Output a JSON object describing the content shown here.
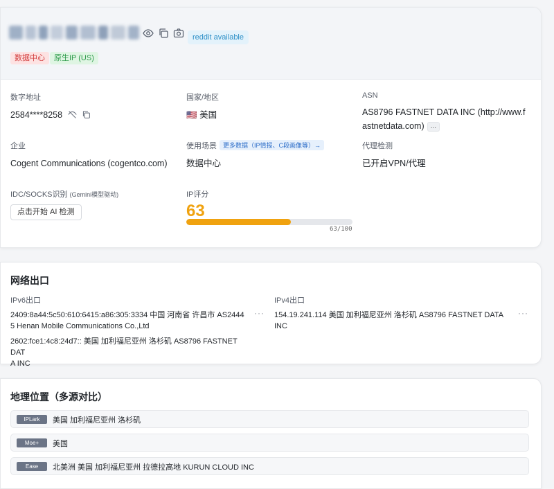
{
  "header": {
    "available_badge": "reddit available",
    "tags": [
      "数据中心",
      "原生IP (US)"
    ],
    "icons": [
      "eye-icon",
      "copy-icon",
      "camera-icon"
    ]
  },
  "info": {
    "digital_addr": {
      "label": "数字地址",
      "value": "2584****8258"
    },
    "country": {
      "label": "国家/地区",
      "flag": "🇺🇸",
      "value": "美国"
    },
    "asn": {
      "label": "ASN",
      "value_line1": "AS8796 FASTNET DATA INC (http://www.f",
      "value_line2": "astnetdata.com)",
      "more": "..."
    },
    "org": {
      "label": "企业",
      "value": "Cogent Communications (cogentco.com)"
    },
    "usage": {
      "label": "使用场景",
      "link": "更多数据（IP情报、C段画像等）→",
      "value": "数据中心"
    },
    "proxy": {
      "label": "代理检测",
      "value": "已开启VPN/代理"
    },
    "idc": {
      "label": "IDC/SOCKS识别",
      "label_note": "(Gemini模型驱动)",
      "button": "点击开始 AI 检测"
    },
    "score": {
      "label": "IP评分",
      "value": "63",
      "caption": "63/100",
      "fraction": 0.63
    }
  },
  "egress": {
    "title": "网络出口",
    "ipv6": {
      "label": "IPv6出口",
      "lines": [
        "2409:8a44:5c50:610:6415:a86:305:3334 中国 河南省 许昌市 AS2444",
        "5 Henan Mobile Communications Co.,Ltd",
        "2602:fce1:4c8:24d7:: 美国 加利福尼亚州 洛杉矶 AS8796 FASTNET DAT",
        "A INC"
      ]
    },
    "ipv4": {
      "label": "IPv4出口",
      "line": "154.19.241.114 美国 加利福尼亚州 洛杉矶 AS8796 FASTNET DATA INC"
    },
    "more": "···"
  },
  "geo": {
    "title": "地理位置（多源对比）",
    "rows": [
      {
        "source": "IPLark",
        "text": "美国 加利福尼亚州 洛杉矶"
      },
      {
        "source": "Moe+",
        "text": "美国"
      },
      {
        "source": "Ease",
        "text": "北美洲 美国 加利福尼亚州 拉德拉高地 KURUN CLOUD INC"
      }
    ]
  },
  "colors": {
    "accent": "#f0a20f",
    "tag_red": "#d23f3f",
    "tag_green": "#2d9a4a",
    "link_blue": "#2f6fc9"
  }
}
